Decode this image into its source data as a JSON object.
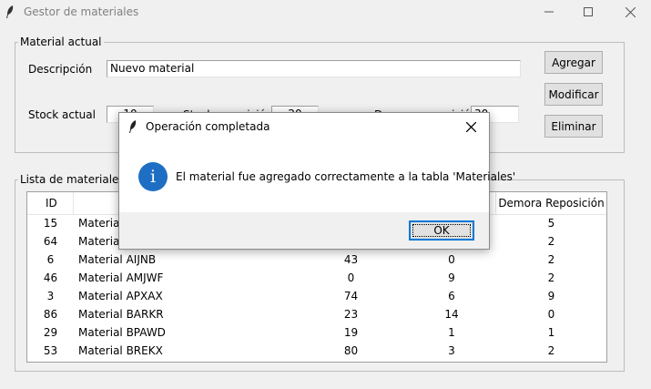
{
  "window": {
    "title": "Gestor de materiales"
  },
  "form": {
    "group_title": "Material actual",
    "descripcion_label": "Descripción",
    "descripcion_value": "Nuevo material",
    "stock_label": "Stock actual",
    "stock_value": "10",
    "stock_repo_label": "Stock reposición",
    "stock_repo_value": "20",
    "demora_label": "Demora reposición",
    "demora_value": "30"
  },
  "buttons": {
    "add": "Agregar",
    "modify": "Modificar",
    "delete": "Eliminar"
  },
  "list": {
    "group_title": "Lista de materiales",
    "headers": [
      "ID",
      "",
      "",
      "",
      "Demora Reposición"
    ],
    "rows": [
      [
        "15",
        "Material",
        "",
        "",
        "5"
      ],
      [
        "64",
        "Material",
        "",
        "",
        "2"
      ],
      [
        "6",
        "Material AIJNB",
        "43",
        "0",
        "2"
      ],
      [
        "46",
        "Material AMJWF",
        "0",
        "9",
        "2"
      ],
      [
        "3",
        "Material APXAX",
        "74",
        "6",
        "9"
      ],
      [
        "86",
        "Material BARKR",
        "23",
        "14",
        "0"
      ],
      [
        "29",
        "Material BPAWD",
        "19",
        "1",
        "1"
      ],
      [
        "53",
        "Material BREKX",
        "80",
        "3",
        "2"
      ]
    ]
  },
  "dialog": {
    "title": "Operación completada",
    "message": "El material fue agregado correctamente a la tabla 'Materiales'",
    "info_icon_glyph": "i",
    "ok": "OK"
  },
  "colors": {
    "info_icon": "#1e6fc4",
    "ok_border": "#0078d7"
  }
}
